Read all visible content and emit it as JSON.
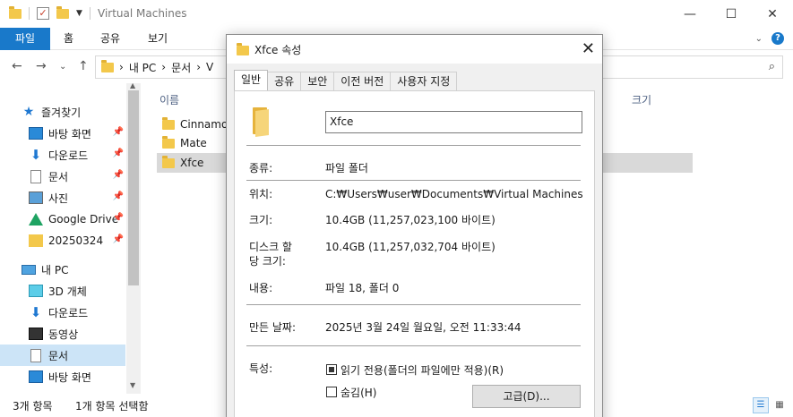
{
  "window": {
    "title": "Virtual Machines"
  },
  "ribbon": {
    "tabs": [
      "파일",
      "홈",
      "공유",
      "보기"
    ]
  },
  "address": {
    "path": [
      "내 PC",
      "문서",
      "V"
    ]
  },
  "nav_pane": {
    "quick_access": "즐겨찾기",
    "items": [
      {
        "label": "바탕 화면",
        "icon": "desktop-icon",
        "pinned": true
      },
      {
        "label": "다운로드",
        "icon": "download-icon",
        "pinned": true
      },
      {
        "label": "문서",
        "icon": "document-icon",
        "pinned": true
      },
      {
        "label": "사진",
        "icon": "picture-icon",
        "pinned": true
      },
      {
        "label": "Google Drive",
        "icon": "google-drive-icon",
        "pinned": true
      },
      {
        "label": "20250324",
        "icon": "folder-icon",
        "pinned": true
      }
    ],
    "this_pc": "내 PC",
    "pc_items": [
      {
        "label": "3D 개체",
        "icon": "cube-icon"
      },
      {
        "label": "다운로드",
        "icon": "download-icon"
      },
      {
        "label": "동영상",
        "icon": "video-icon"
      },
      {
        "label": "문서",
        "icon": "document-icon",
        "selected": true
      },
      {
        "label": "바탕 화면",
        "icon": "desktop-icon"
      }
    ]
  },
  "file_list": {
    "col_name": "이름",
    "col_size": "크기",
    "rows": [
      {
        "name": "Cinnamon"
      },
      {
        "name": "Mate"
      },
      {
        "name": "Xfce",
        "selected": true
      }
    ]
  },
  "status": {
    "count": "3개 항목",
    "selection": "1개 항목 선택함"
  },
  "dialog": {
    "title": "Xfce 속성",
    "tabs": [
      "일반",
      "공유",
      "보안",
      "이전 버전",
      "사용자 지정"
    ],
    "name": "Xfce",
    "props": {
      "type_label": "종류:",
      "type_value": "파일 폴더",
      "location_label": "위치:",
      "location_value": "C:₩Users₩user₩Documents₩Virtual Machines",
      "size_label": "크기:",
      "size_value": "10.4GB (11,257,023,100 바이트)",
      "disk_label_1": "디스크 할",
      "disk_label_2": "당 크기:",
      "disk_value": "10.4GB (11,257,032,704 바이트)",
      "contents_label": "내용:",
      "contents_value": "파일 18, 폴더 0",
      "created_label": "만든 날짜:",
      "created_value": "2025년 3월 24일 월요일, 오전 11:33:44",
      "attr_label": "특성:",
      "readonly_label": "읽기 전용(폴더의 파일에만 적용)(R)",
      "hidden_label": "숨김(H)",
      "advanced_label": "고급(D)..."
    }
  }
}
